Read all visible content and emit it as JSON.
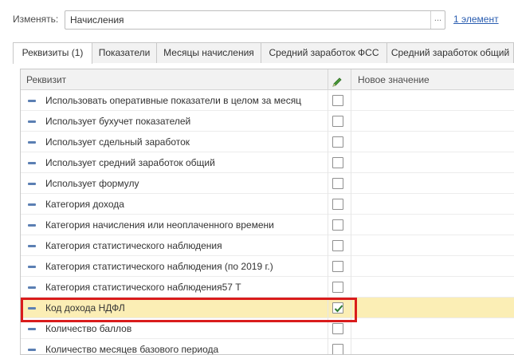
{
  "header": {
    "change_label": "Изменять:",
    "target_value": "Начисления",
    "select_button": "...",
    "count_link": "1 элемент"
  },
  "tabs": [
    {
      "label": "Реквизиты (1)",
      "active": true
    },
    {
      "label": "Показатели",
      "active": false
    },
    {
      "label": "Месяцы начисления",
      "active": false
    },
    {
      "label": "Средний заработок ФСС",
      "active": false
    },
    {
      "label": "Средний заработок общий",
      "active": false
    }
  ],
  "grid": {
    "columns": {
      "attribute": "Реквизит",
      "edit_icon": "pencil-icon",
      "new_value": "Новое значение"
    },
    "rows": [
      {
        "label": "Использовать оперативные показатели в целом за месяц",
        "checked": false,
        "selected": false
      },
      {
        "label": "Использует бухучет показателей",
        "checked": false,
        "selected": false
      },
      {
        "label": "Использует сдельный заработок",
        "checked": false,
        "selected": false
      },
      {
        "label": "Использует средний заработок общий",
        "checked": false,
        "selected": false
      },
      {
        "label": "Использует формулу",
        "checked": false,
        "selected": false
      },
      {
        "label": "Категория дохода",
        "checked": false,
        "selected": false
      },
      {
        "label": "Категория начисления или неоплаченного времени",
        "checked": false,
        "selected": false
      },
      {
        "label": "Категория статистического наблюдения",
        "checked": false,
        "selected": false
      },
      {
        "label": "Категория статистического наблюдения (по 2019 г.)",
        "checked": false,
        "selected": false
      },
      {
        "label": "Категория статистического наблюдения57 Т",
        "checked": false,
        "selected": false
      },
      {
        "label": "Код дохода НДФЛ",
        "checked": true,
        "selected": true
      },
      {
        "label": "Количество баллов",
        "checked": false,
        "selected": false
      },
      {
        "label": "Количество месяцев базового периода",
        "checked": false,
        "selected": false
      }
    ]
  },
  "colors": {
    "selected_row": "#fbeeb5",
    "highlight_frame": "#d91c1c",
    "check": "#2e7d32",
    "link": "#2a5db0"
  }
}
